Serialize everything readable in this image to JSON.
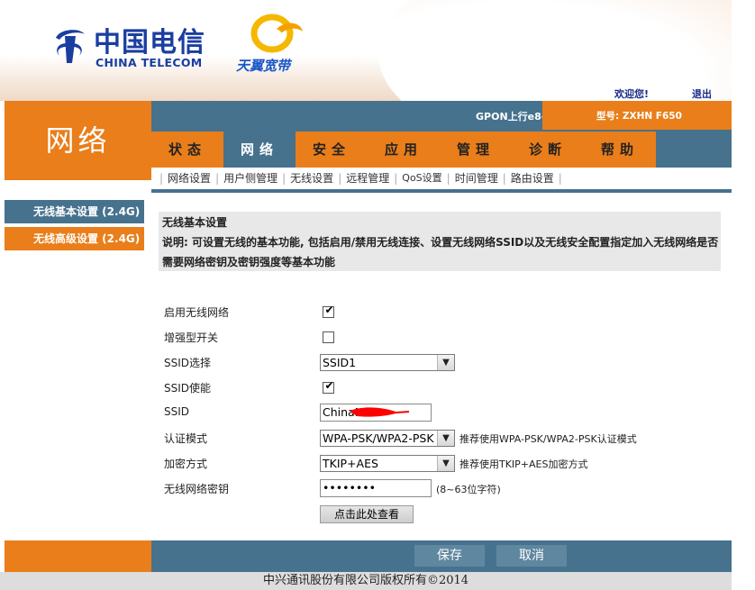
{
  "header": {
    "brand_cn": "中国电信",
    "brand_en": "CHINA TELECOM",
    "sub_brand": "天翼宽带",
    "welcome": "欢迎您!",
    "logout": "退出"
  },
  "topbar": {
    "gpon": "GPON上行e8-C",
    "model": "型号: ZXHN F650"
  },
  "section_title": "网络",
  "tabs": [
    {
      "label": "状态"
    },
    {
      "label": "网络"
    },
    {
      "label": "安全"
    },
    {
      "label": "应用"
    },
    {
      "label": "管理"
    },
    {
      "label": "诊断"
    },
    {
      "label": "帮助"
    }
  ],
  "active_tab": "网络",
  "subnav": [
    {
      "label": "网络设置"
    },
    {
      "label": "用户侧管理"
    },
    {
      "label": "无线设置"
    },
    {
      "label": "远程管理"
    },
    {
      "label": "QoS设置"
    },
    {
      "label": "时间管理"
    },
    {
      "label": "路由设置"
    }
  ],
  "sidebar": [
    {
      "label": "无线基本设置 (2.4G)"
    },
    {
      "label": "无线高级设置 (2.4G)"
    }
  ],
  "description": {
    "title": "无线基本设置",
    "text": "说明: 可设置无线的基本功能, 包括启用/禁用无线连接、设置无线网络SSID以及无线安全配置指定加入无线网络是否需要网络密钥及密钥强度等基本功能"
  },
  "form": {
    "enable_wireless": {
      "label": "启用无线网络",
      "checked": true
    },
    "enhanced_switch": {
      "label": "增强型开关",
      "checked": false
    },
    "ssid_select": {
      "label": "SSID选择",
      "value": "SSID1"
    },
    "ssid_enable": {
      "label": "SSID使能",
      "checked": true
    },
    "ssid": {
      "label": "SSID",
      "value": "ChinaN"
    },
    "auth_mode": {
      "label": "认证模式",
      "value": "WPA-PSK/WPA2-PSK",
      "hint": "推荐使用WPA-PSK/WPA2-PSK认证模式"
    },
    "encryption": {
      "label": "加密方式",
      "value": "TKIP+AES",
      "hint": "推荐使用TKIP+AES加密方式"
    },
    "wireless_key": {
      "label": "无线网络密钥",
      "value": "••••••••",
      "hint": "(8~63位字符)"
    },
    "view_button": "点击此处查看"
  },
  "actions": {
    "save": "保存",
    "cancel": "取消"
  },
  "footer": "中兴通讯股份有限公司版权所有©2014",
  "colors": {
    "orange": "#e97e1a",
    "steel_blue": "#46728e",
    "brand_blue": "#1a3ea0"
  },
  "icons": [
    "checkbox-checked-icon",
    "checkbox-empty-icon",
    "dropdown-arrow-icon",
    "china-telecom-logo",
    "tianyi-logo"
  ]
}
